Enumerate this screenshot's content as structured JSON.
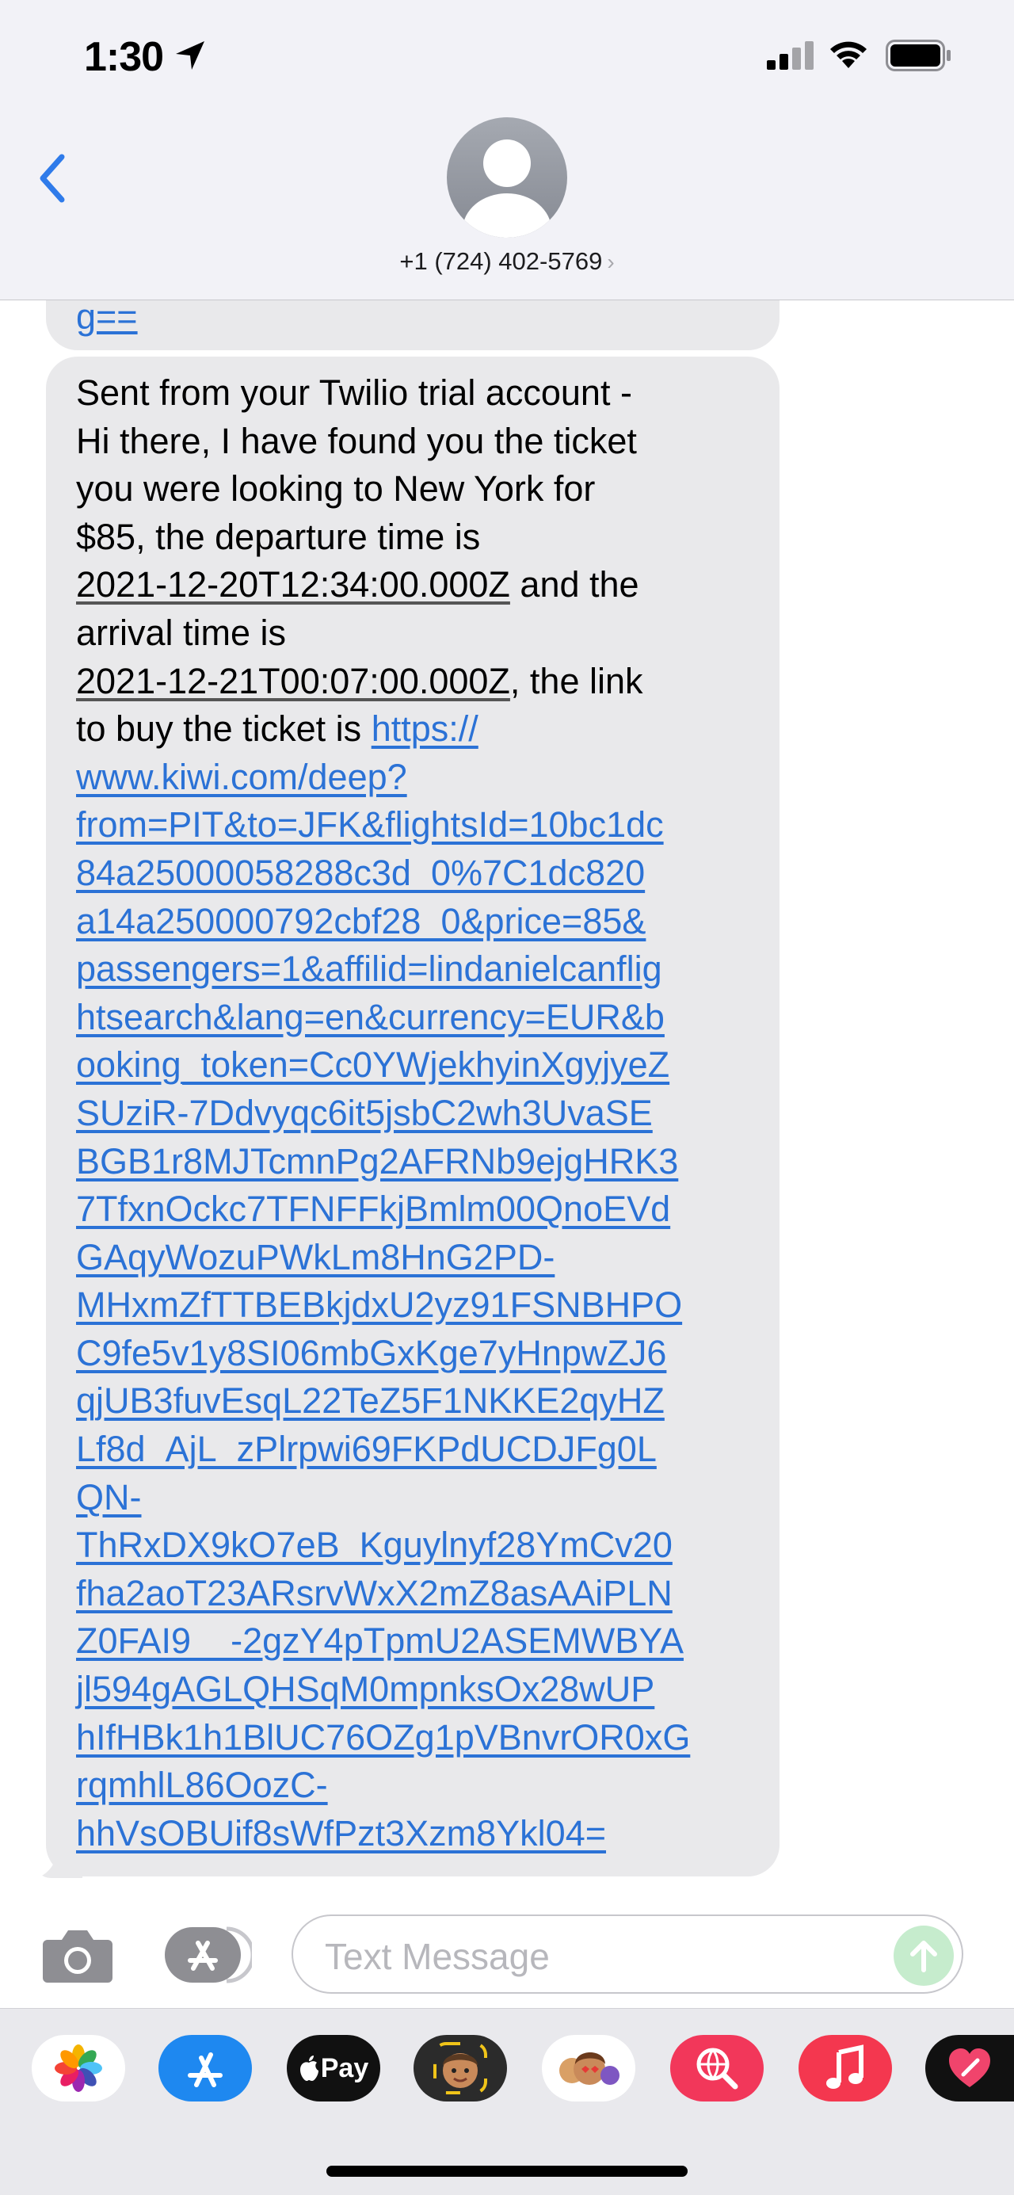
{
  "status_bar": {
    "time": "1:30"
  },
  "header": {
    "contact": "+1 (724) 402-5769"
  },
  "messages": {
    "previous_tail": "g==",
    "main": {
      "line1": "Sent from your Twilio trial account -",
      "line2": "Hi there, I have found you the ticket",
      "line3": "you were looking to New York for",
      "line4": "$85, the departure time is",
      "departure": "2021-12-20T12:34:00.000Z",
      "line5_rest": " and the",
      "line6": "arrival time is",
      "arrival": "2021-12-21T00:07:00.000Z",
      "line7_rest": ", the link",
      "line8_pre": "to buy the ticket is ",
      "link_lines": [
        "https://",
        "www.kiwi.com/deep?",
        "from=PIT&to=JFK&flightsId=10bc1dc",
        "84a25000058288c3d_0%7C1dc820",
        "a14a250000792cbf28_0&price=85&",
        "passengers=1&affilid=lindanielcanflig",
        "htsearch&lang=en&currency=EUR&b",
        "ooking_token=Cc0YWjekhyinXgyjyeZ",
        "SUziR-7Ddvyqc6it5jsbC2wh3UvaSE",
        "BGB1r8MJTcmnPg2AFRNb9ejgHRK3",
        "7TfxnOckc7TFNFFkjBmlm00QnoEVd",
        "GAqyWozuPWkLm8HnG2PD-",
        "MHxmZfTTBEBkjdxU2yz91FSNBHPO",
        "C9fe5v1y8SI06mbGxKge7yHnpwZJ6",
        "qjUB3fuvEsqL22TeZ5F1NKKE2qyHZ",
        "Lf8d_AjL_zPlrpwi69FKPdUCDJFg0L",
        "QN-",
        "ThRxDX9kO7eB_Kguylnyf28YmCv20",
        "fha2aoT23ARsrvWxX2mZ8asAAiPLN",
        "Z0FAI9__-2gzY4pTpmU2ASEMWBYA",
        "jl594gAGLQHSqM0mpnksOx28wUP",
        "hIfHBk1h1BlUC76OZg1pVBnvrOR0xG",
        "rqmhlL86OozC-",
        "hhVsOBUif8sWfPzt3Xzm8Ykl04="
      ]
    }
  },
  "composer": {
    "placeholder": "Text Message"
  },
  "app_drawer": {
    "apple_pay_label": "Pay"
  }
}
